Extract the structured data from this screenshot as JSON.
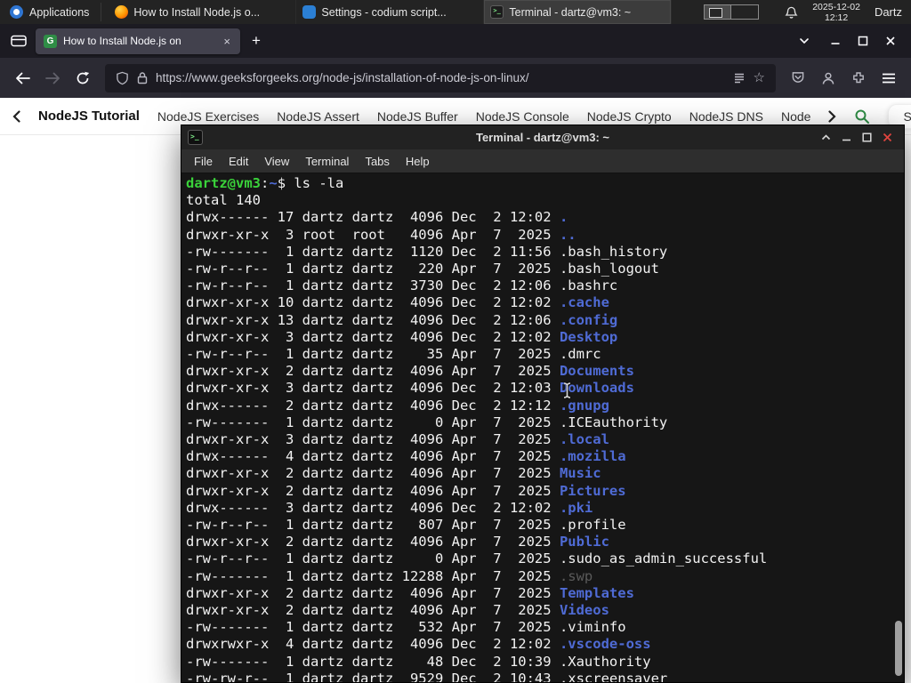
{
  "colors": {
    "panel_bg": "#232323",
    "accent_green": "#2f8d46",
    "terminal_prompt_green": "#3ad23a",
    "terminal_dir_blue": "#4f6bd5",
    "terminal_dim_gray": "#5a5a5a",
    "terminal_close_red": "#e0443e"
  },
  "panel": {
    "applications_label": "Applications",
    "tasks": [
      {
        "icon": "firefox",
        "label": "How to Install Node.js o...",
        "active": false
      },
      {
        "icon": "codium",
        "label": "Settings - codium script...",
        "active": false
      },
      {
        "icon": "terminal",
        "label": "Terminal - dartz@vm3: ~",
        "active": true
      }
    ],
    "clock_date": "2025-12-02",
    "clock_time": "12:12",
    "user_label": "Dartz"
  },
  "browser": {
    "tab_title": "How to Install Node.js on",
    "favicon_glyph": "G",
    "new_tab_glyph": "+",
    "tab_close_glyph": "×",
    "star_glyph": "☆",
    "url": "https://www.geeksforgeeks.org/node-js/installation-of-node-js-on-linux/"
  },
  "site_nav": {
    "title": "NodeJS Tutorial",
    "links": [
      "NodeJS Exercises",
      "NodeJS Assert",
      "NodeJS Buffer",
      "NodeJS Console",
      "NodeJS Crypto",
      "NodeJS DNS",
      "Node"
    ],
    "sign_in_label": "Sign In"
  },
  "terminal": {
    "window_title": "Terminal - dartz@vm3: ~",
    "menu": [
      "File",
      "Edit",
      "View",
      "Terminal",
      "Tabs",
      "Help"
    ],
    "lines": [
      {
        "seg": [
          {
            "t": "dartz@vm3",
            "c": "green"
          },
          {
            "t": ":",
            "c": "fg"
          },
          {
            "t": "~",
            "c": "blue"
          },
          {
            "t": "$ ls -la",
            "c": "fg"
          }
        ]
      },
      {
        "seg": [
          {
            "t": "total 140",
            "c": "fg"
          }
        ]
      },
      {
        "seg": [
          {
            "t": "drwx------ 17 dartz dartz  4096 Dec  2 12:02 ",
            "c": "fg"
          },
          {
            "t": ".",
            "c": "blue"
          }
        ]
      },
      {
        "seg": [
          {
            "t": "drwxr-xr-x  3 root  root   4096 Apr  7  2025 ",
            "c": "fg"
          },
          {
            "t": "..",
            "c": "blue"
          }
        ]
      },
      {
        "seg": [
          {
            "t": "-rw-------  1 dartz dartz  1120 Dec  2 11:56 ",
            "c": "fg"
          },
          {
            "t": ".bash_history",
            "c": "fg"
          }
        ]
      },
      {
        "seg": [
          {
            "t": "-rw-r--r--  1 dartz dartz   220 Apr  7  2025 ",
            "c": "fg"
          },
          {
            "t": ".bash_logout",
            "c": "fg"
          }
        ]
      },
      {
        "seg": [
          {
            "t": "-rw-r--r--  1 dartz dartz  3730 Dec  2 12:06 ",
            "c": "fg"
          },
          {
            "t": ".bashrc",
            "c": "fg"
          }
        ]
      },
      {
        "seg": [
          {
            "t": "drwxr-xr-x 10 dartz dartz  4096 Dec  2 12:02 ",
            "c": "fg"
          },
          {
            "t": ".cache",
            "c": "blue"
          }
        ]
      },
      {
        "seg": [
          {
            "t": "drwxr-xr-x 13 dartz dartz  4096 Dec  2 12:06 ",
            "c": "fg"
          },
          {
            "t": ".config",
            "c": "blue"
          }
        ]
      },
      {
        "seg": [
          {
            "t": "drwxr-xr-x  3 dartz dartz  4096 Dec  2 12:02 ",
            "c": "fg"
          },
          {
            "t": "Desktop",
            "c": "blue"
          }
        ]
      },
      {
        "seg": [
          {
            "t": "-rw-r--r--  1 dartz dartz    35 Apr  7  2025 ",
            "c": "fg"
          },
          {
            "t": ".dmrc",
            "c": "fg"
          }
        ]
      },
      {
        "seg": [
          {
            "t": "drwxr-xr-x  2 dartz dartz  4096 Apr  7  2025 ",
            "c": "fg"
          },
          {
            "t": "Documents",
            "c": "blue"
          }
        ]
      },
      {
        "seg": [
          {
            "t": "drwxr-xr-x  3 dartz dartz  4096 Dec  2 12:03 ",
            "c": "fg"
          },
          {
            "t": "Downloads",
            "c": "blue"
          }
        ]
      },
      {
        "seg": [
          {
            "t": "drwx------  2 dartz dartz  4096 Dec  2 12:12 ",
            "c": "fg"
          },
          {
            "t": ".gnupg",
            "c": "blue"
          }
        ]
      },
      {
        "seg": [
          {
            "t": "-rw-------  1 dartz dartz     0 Apr  7  2025 ",
            "c": "fg"
          },
          {
            "t": ".ICEauthority",
            "c": "fg"
          }
        ]
      },
      {
        "seg": [
          {
            "t": "drwxr-xr-x  3 dartz dartz  4096 Apr  7  2025 ",
            "c": "fg"
          },
          {
            "t": ".local",
            "c": "blue"
          }
        ]
      },
      {
        "seg": [
          {
            "t": "drwx------  4 dartz dartz  4096 Apr  7  2025 ",
            "c": "fg"
          },
          {
            "t": ".mozilla",
            "c": "blue"
          }
        ]
      },
      {
        "seg": [
          {
            "t": "drwxr-xr-x  2 dartz dartz  4096 Apr  7  2025 ",
            "c": "fg"
          },
          {
            "t": "Music",
            "c": "blue"
          }
        ]
      },
      {
        "seg": [
          {
            "t": "drwxr-xr-x  2 dartz dartz  4096 Apr  7  2025 ",
            "c": "fg"
          },
          {
            "t": "Pictures",
            "c": "blue"
          }
        ]
      },
      {
        "seg": [
          {
            "t": "drwx------  3 dartz dartz  4096 Dec  2 12:02 ",
            "c": "fg"
          },
          {
            "t": ".pki",
            "c": "blue"
          }
        ]
      },
      {
        "seg": [
          {
            "t": "-rw-r--r--  1 dartz dartz   807 Apr  7  2025 ",
            "c": "fg"
          },
          {
            "t": ".profile",
            "c": "fg"
          }
        ]
      },
      {
        "seg": [
          {
            "t": "drwxr-xr-x  2 dartz dartz  4096 Apr  7  2025 ",
            "c": "fg"
          },
          {
            "t": "Public",
            "c": "blue"
          }
        ]
      },
      {
        "seg": [
          {
            "t": "-rw-r--r--  1 dartz dartz     0 Apr  7  2025 ",
            "c": "fg"
          },
          {
            "t": ".sudo_as_admin_successful",
            "c": "fg"
          }
        ]
      },
      {
        "seg": [
          {
            "t": "-rw-------  1 dartz dartz 12288 Apr  7  2025 ",
            "c": "fg"
          },
          {
            "t": ".swp",
            "c": "dim"
          }
        ]
      },
      {
        "seg": [
          {
            "t": "drwxr-xr-x  2 dartz dartz  4096 Apr  7  2025 ",
            "c": "fg"
          },
          {
            "t": "Templates",
            "c": "blue"
          }
        ]
      },
      {
        "seg": [
          {
            "t": "drwxr-xr-x  2 dartz dartz  4096 Apr  7  2025 ",
            "c": "fg"
          },
          {
            "t": "Videos",
            "c": "blue"
          }
        ]
      },
      {
        "seg": [
          {
            "t": "-rw-------  1 dartz dartz   532 Apr  7  2025 ",
            "c": "fg"
          },
          {
            "t": ".viminfo",
            "c": "fg"
          }
        ]
      },
      {
        "seg": [
          {
            "t": "drwxrwxr-x  4 dartz dartz  4096 Dec  2 12:02 ",
            "c": "fg"
          },
          {
            "t": ".vscode-oss",
            "c": "blue"
          }
        ]
      },
      {
        "seg": [
          {
            "t": "-rw-------  1 dartz dartz    48 Dec  2 10:39 ",
            "c": "fg"
          },
          {
            "t": ".Xauthority",
            "c": "fg"
          }
        ]
      },
      {
        "seg": [
          {
            "t": "-rw-rw-r--  1 dartz dartz  9529 Dec  2 10:43 ",
            "c": "fg"
          },
          {
            "t": ".xscreensaver",
            "c": "fg"
          }
        ]
      }
    ]
  }
}
